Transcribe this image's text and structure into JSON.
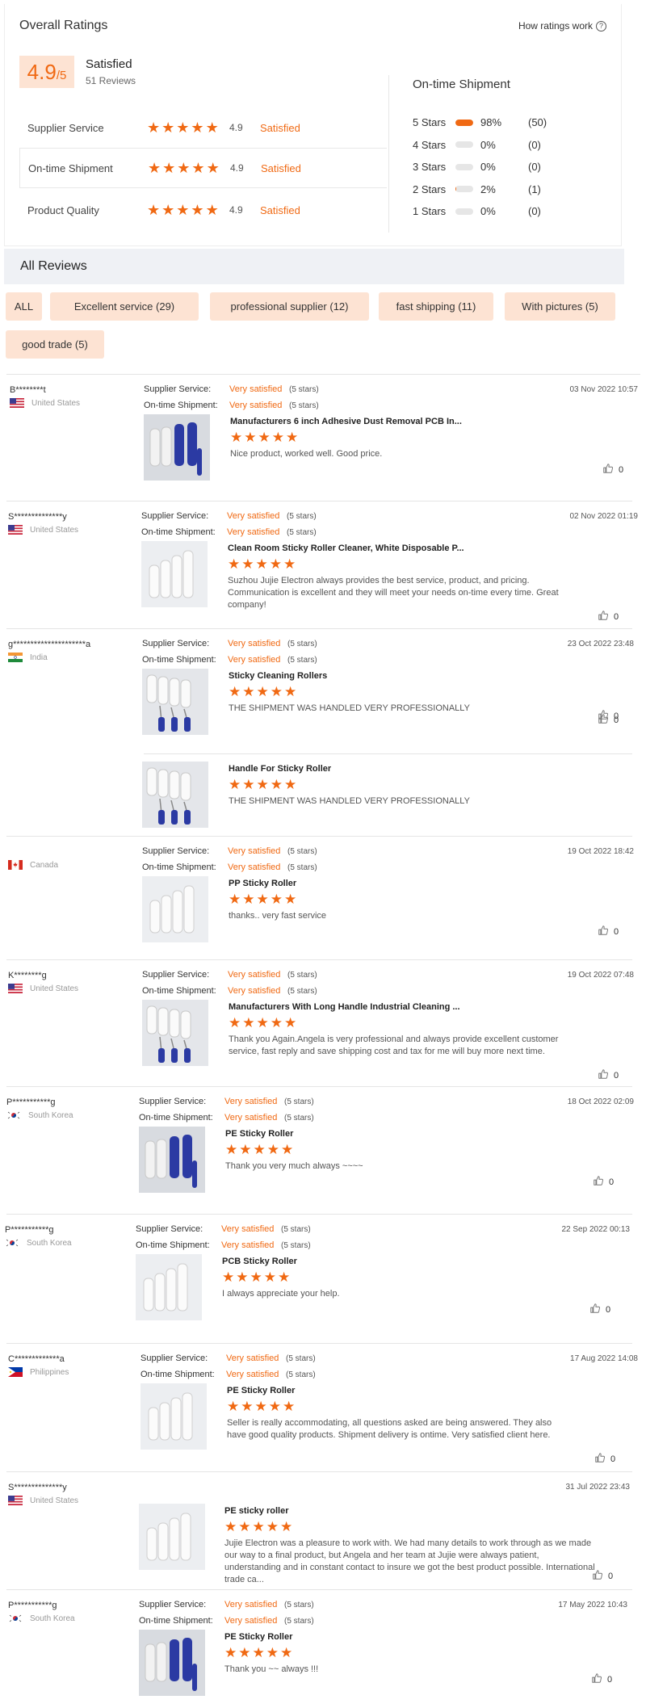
{
  "overall": {
    "title": "Overall Ratings",
    "how_link": "How ratings work",
    "score": "4.9",
    "score_den": "/5",
    "satisfaction": "Satisfied",
    "review_count": "51 Reviews",
    "rows": [
      {
        "label": "Supplier Service",
        "stars": 5,
        "value": "4.9",
        "status": "Satisfied"
      },
      {
        "label": "On-time Shipment",
        "stars": 5,
        "value": "4.9",
        "status": "Satisfied"
      },
      {
        "label": "Product Quality",
        "stars": 5,
        "value": "4.9",
        "status": "Satisfied"
      }
    ],
    "shipment": {
      "title": "On-time Shipment",
      "dist": [
        {
          "label": "5 Stars",
          "fraction": 0.98,
          "pct": "98%",
          "count": "(50)"
        },
        {
          "label": "4 Stars",
          "fraction": 0,
          "pct": "0%",
          "count": "(0)"
        },
        {
          "label": "3 Stars",
          "fraction": 0,
          "pct": "0%",
          "count": "(0)"
        },
        {
          "label": "2 Stars",
          "fraction": 0.02,
          "pct": "2%",
          "count": "(1)"
        },
        {
          "label": "1 Stars",
          "fraction": 0,
          "pct": "0%",
          "count": "(0)"
        }
      ]
    }
  },
  "all_reviews": {
    "title": "All Reviews",
    "filters": [
      "ALL",
      "Excellent service (29)",
      "professional supplier (12)",
      "fast shipping (11)",
      "With pictures (5)",
      "good trade (5)"
    ]
  },
  "labels": {
    "supplier_service": "Supplier Service:",
    "ontime_shipment": "On-time Shipment:",
    "very_satisfied": "Very satisfied",
    "five_stars": "(5 stars)"
  },
  "colors": {
    "accent": "#f06913",
    "chip_bg": "#fde3d3",
    "section_bg": "#eff1f5"
  },
  "reviews": [
    {
      "user": "B********t",
      "country": "United States",
      "flag": "us",
      "date": "03 Nov 2022 10:57",
      "meta": true,
      "items": [
        {
          "product": "Manufacturers 6 inch Adhesive Dust Removal PCB In...",
          "text": "Nice product, worked well. Good price.",
          "likes": "0",
          "thumb": "rollers-blue"
        }
      ]
    },
    {
      "user": "S**************y",
      "country": "United States",
      "flag": "us",
      "date": "02 Nov 2022 01:19",
      "meta": true,
      "items": [
        {
          "product": "Clean Room Sticky Roller Cleaner, White Disposable P...",
          "text": "Suzhou Jujie Electron always provides the best service, product, and pricing. Communication is excellent and they will meet your needs on-time every time.  Great company!",
          "likes": "0",
          "thumb": "rollers-white"
        }
      ]
    },
    {
      "user": "g*********************a",
      "country": "India",
      "flag": "in",
      "date": "23 Oct 2022 23:48",
      "meta": true,
      "items": [
        {
          "product": "Sticky Cleaning Rollers",
          "text": "THE SHIPMENT WAS HANDLED VERY PROFESSIONALLY",
          "likes": "0",
          "thumb": "handles"
        },
        {
          "product": "Handle For Sticky Roller",
          "text": "THE SHIPMENT WAS HANDLED VERY PROFESSIONALLY",
          "likes": "0",
          "thumb": "handles"
        }
      ]
    },
    {
      "user": "",
      "country": "Canada",
      "flag": "ca",
      "date": "19 Oct 2022 18:42",
      "meta": true,
      "items": [
        {
          "product": "PP Sticky Roller",
          "text": "thanks.. very fast service",
          "likes": "0",
          "thumb": "rollers-white"
        }
      ]
    },
    {
      "user": "K********g",
      "country": "United States",
      "flag": "us",
      "date": "19 Oct 2022  07:48",
      "meta": true,
      "items": [
        {
          "product": "Manufacturers With Long Handle Industrial Cleaning ...",
          "text": "Thank you Again.Angela is very professional and always provide excellent customer service, fast reply and save shipping cost and tax for me will buy more next time.",
          "likes": "0",
          "thumb": "handles"
        }
      ]
    },
    {
      "user": "P***********g",
      "country": "South Korea",
      "flag": "kr",
      "date": "18 Oct 2022 02:09",
      "meta": true,
      "items": [
        {
          "product": "PE Sticky Roller",
          "text": "Thank you very much always ~~~~",
          "likes": "0",
          "thumb": "rollers-blue"
        }
      ]
    },
    {
      "user": "P***********g",
      "country": "South Korea",
      "flag": "kr",
      "date": "22 Sep 2022 00:13",
      "meta": true,
      "items": [
        {
          "product": "PCB Sticky Roller",
          "text": "I always appreciate your help.",
          "likes": "0",
          "thumb": "rollers-white"
        }
      ]
    },
    {
      "user": "C*************a",
      "country": "Philippines",
      "flag": "ph",
      "date": "17 Aug 2022 14:08",
      "meta": true,
      "items": [
        {
          "product": "PE Sticky Roller",
          "text": "Seller is really accommodating, all questions asked are being answered. They also have good quality products. Shipment delivery is ontime. Very satisfied client here.",
          "likes": "0",
          "thumb": "rollers-white"
        }
      ]
    },
    {
      "user": "S**************y",
      "country": "United States",
      "flag": "us",
      "date": "31 Jul 2022 23:43",
      "meta": false,
      "items": [
        {
          "product": "PE sticky roller",
          "text": "Jujie Electron was a pleasure to work with.  We had many details to work through as we made our way to a final product, but Angela and her team at Jujie were always patient, understanding and  in constant contact to insure we got the best product possible.  International trade ca...",
          "likes": "0",
          "thumb": "rollers-white"
        }
      ]
    },
    {
      "user": "P***********g",
      "country": "South Korea",
      "flag": "kr",
      "date": "17 May 2022 10:43",
      "meta": true,
      "items": [
        {
          "product": "PE Sticky Roller",
          "text": "Thank you ~~ always !!!",
          "likes": "0",
          "thumb": "rollers-blue"
        }
      ]
    }
  ]
}
